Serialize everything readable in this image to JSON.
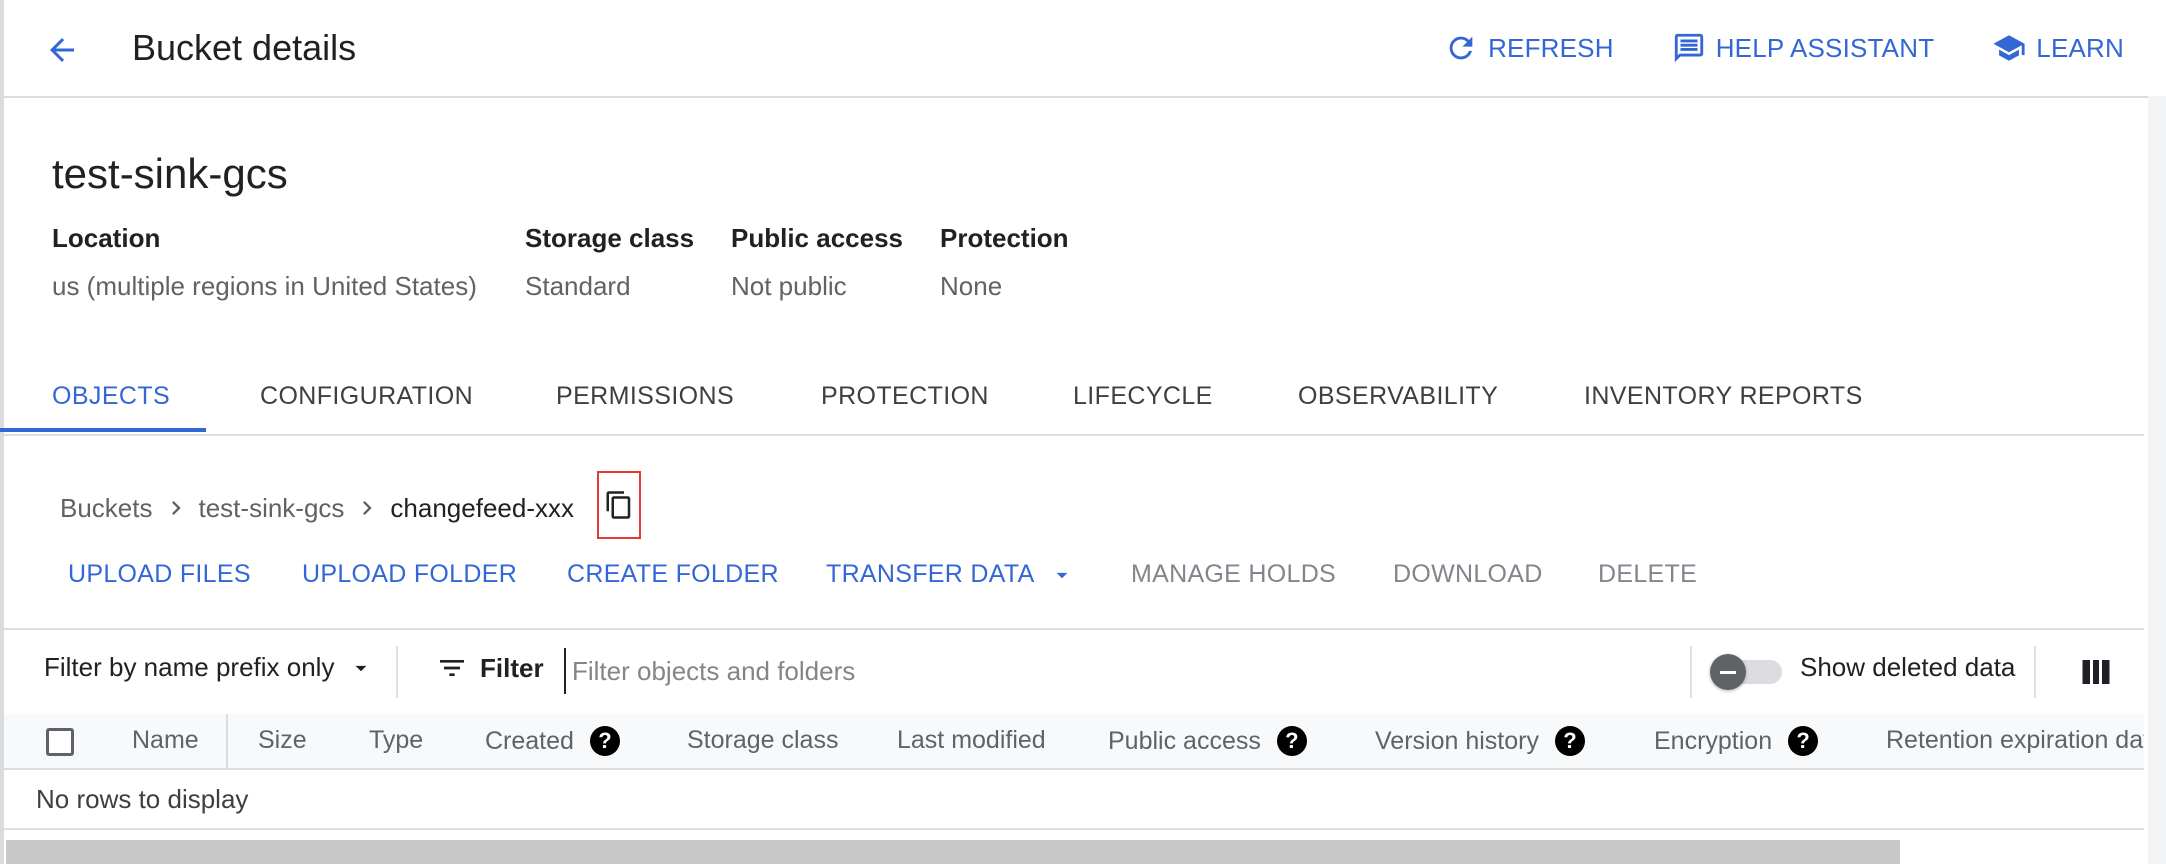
{
  "header": {
    "title": "Bucket details",
    "actions": {
      "refresh": "REFRESH",
      "help_assistant": "HELP ASSISTANT",
      "learn": "LEARN"
    }
  },
  "bucket": {
    "name": "test-sink-gcs",
    "meta": {
      "location": {
        "label": "Location",
        "value": "us (multiple regions in United States)"
      },
      "storage_class": {
        "label": "Storage class",
        "value": "Standard"
      },
      "public_access": {
        "label": "Public access",
        "value": "Not public"
      },
      "protection": {
        "label": "Protection",
        "value": "None"
      }
    }
  },
  "tabs": {
    "objects": "OBJECTS",
    "configuration": "CONFIGURATION",
    "permissions": "PERMISSIONS",
    "protection": "PROTECTION",
    "lifecycle": "LIFECYCLE",
    "observability": "OBSERVABILITY",
    "inventory_reports": "INVENTORY REPORTS",
    "active": "OBJECTS"
  },
  "breadcrumb": {
    "buckets": "Buckets",
    "bucket": "test-sink-gcs",
    "folder": "changefeed-xxx"
  },
  "toolbar": {
    "upload_files": "UPLOAD FILES",
    "upload_folder": "UPLOAD FOLDER",
    "create_folder": "CREATE FOLDER",
    "transfer_data": "TRANSFER DATA",
    "manage_holds": "MANAGE HOLDS",
    "download": "DOWNLOAD",
    "delete": "DELETE"
  },
  "filter": {
    "mode": "Filter by name prefix only",
    "label": "Filter",
    "placeholder": "Filter objects and folders",
    "value": "",
    "show_deleted_label": "Show deleted data",
    "show_deleted_on": false
  },
  "table": {
    "columns": {
      "name": "Name",
      "size": "Size",
      "type": "Type",
      "created": "Created",
      "storage_class": "Storage class",
      "last_modified": "Last modified",
      "public_access": "Public access",
      "version_history": "Version history",
      "encryption": "Encryption",
      "retention": "Retention expiration date"
    },
    "help_glyph": "?",
    "empty_message": "No rows to display"
  },
  "colors": {
    "accent": "#3367d6",
    "text": "#202124",
    "muted": "#5f6368",
    "highlight": "#e53935"
  },
  "icons": {
    "back": "arrow-back-icon",
    "refresh": "refresh-icon",
    "help_assistant": "chat-feedback-icon",
    "learn": "school-icon",
    "breadcrumb_sep": "chevron-right-icon",
    "copy": "copy-icon",
    "transfer_dropdown": "caret-down-icon",
    "filter_mode_dropdown": "caret-down-icon",
    "filter": "filter-list-icon",
    "columns": "column-display-icon"
  }
}
